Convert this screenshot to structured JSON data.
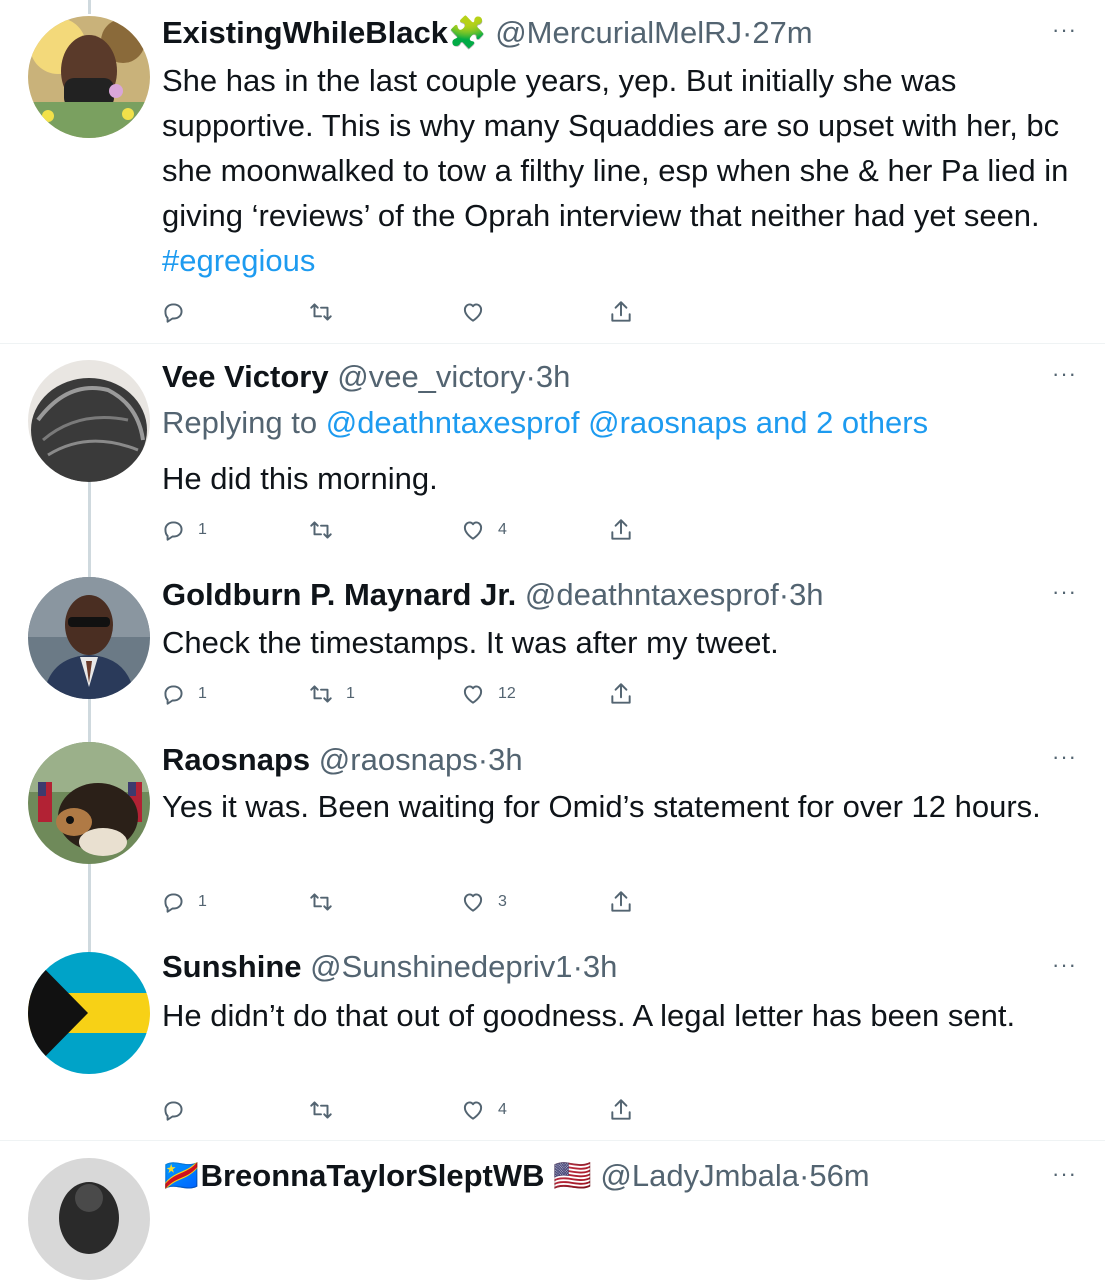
{
  "tweets": [
    {
      "name": "ExistingWhileBlack",
      "emoji": "🧩",
      "handle": "@MercurialMelRJ",
      "time": "27m",
      "text": "She has in the last couple years, yep. But initially she was supportive. This is why many Squaddies are so upset with her, bc she moonwalked to tow a filthy line, esp when she & her Pa lied in giving ‘reviews’ of the Oprah interview that neither had yet seen. ",
      "hashtag": "#egregious",
      "replies": "",
      "retweets": "",
      "likes": ""
    },
    {
      "name": "Vee Victory",
      "handle": "@vee_victory",
      "time": "3h",
      "replying_prefix": "Replying to ",
      "replying_to": "@deathntaxesprof @raosnaps and 2 others",
      "text": "He did this morning.",
      "replies": "1",
      "retweets": "",
      "likes": "4"
    },
    {
      "name": "Goldburn P. Maynard Jr.",
      "handle": "@deathntaxesprof",
      "time": "3h",
      "text": "Check the timestamps. It was after my tweet.",
      "replies": "1",
      "retweets": "1",
      "likes": "12"
    },
    {
      "name": "Raosnaps",
      "handle": "@raosnaps",
      "time": "3h",
      "text": "Yes it was. Been waiting for Omid’s statement for over 12 hours.",
      "replies": "1",
      "retweets": "",
      "likes": "3"
    },
    {
      "name": "Sunshine",
      "handle": "@Sunshinedepriv1",
      "time": "3h",
      "text": "He didn’t do that out of goodness. A legal letter has been sent.",
      "replies": "",
      "retweets": "",
      "likes": "4"
    },
    {
      "name": "BreonnaTaylorSleptWB",
      "flag_left": "🇨🇩",
      "flag_right": "🇺🇸",
      "handle": "@LadyJmbala",
      "time": "56m"
    }
  ],
  "ui": {
    "dot": "·",
    "more": "···",
    "icons": [
      "reply-icon",
      "retweet-icon",
      "like-icon",
      "share-icon",
      "more-icon"
    ],
    "colors": {
      "link": "#1d9bf0",
      "muted": "#536471",
      "text": "#0f1419",
      "thread_line": "#cfd9de"
    }
  }
}
